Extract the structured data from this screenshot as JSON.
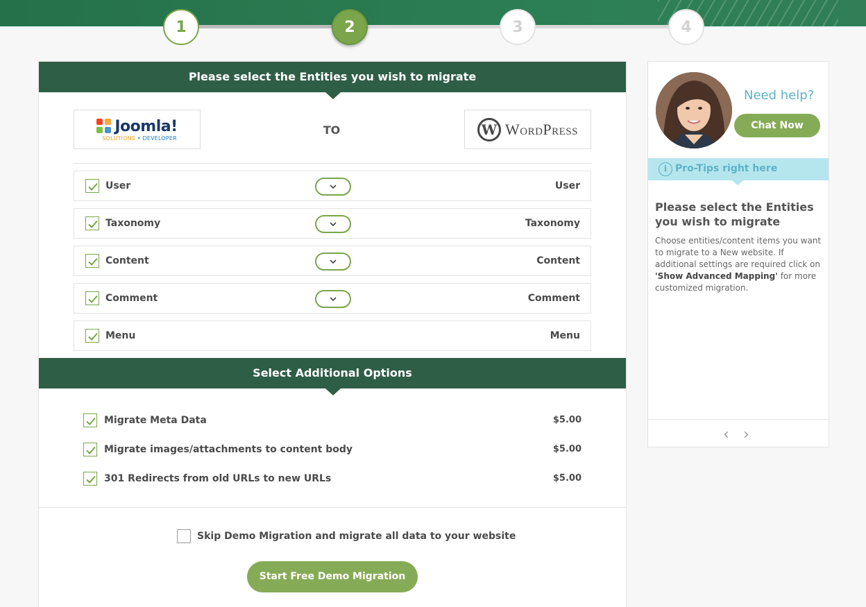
{
  "steps": [
    {
      "number": "1",
      "state": "complete"
    },
    {
      "number": "2",
      "state": "active"
    },
    {
      "number": "3",
      "state": "pending"
    },
    {
      "number": "4",
      "state": "pending"
    }
  ],
  "entities_section": {
    "title": "Please select the Entities you wish to migrate",
    "source_logo": {
      "name": "Joomla!",
      "subtitle_a": "SOLUTIONS",
      "subtitle_b": "DEVELOPER"
    },
    "to_label": "TO",
    "target_logo": {
      "name": "WordPress"
    },
    "rows": [
      {
        "left": "User",
        "right": "User",
        "checked": true,
        "has_toggle": true
      },
      {
        "left": "Taxonomy",
        "right": "Taxonomy",
        "checked": true,
        "has_toggle": true
      },
      {
        "left": "Content",
        "right": "Content",
        "checked": true,
        "has_toggle": true
      },
      {
        "left": "Comment",
        "right": "Comment",
        "checked": true,
        "has_toggle": true
      },
      {
        "left": "Menu",
        "right": "Menu",
        "checked": true,
        "has_toggle": false
      }
    ]
  },
  "options_section": {
    "title": "Select Additional Options",
    "options": [
      {
        "label": "Migrate Meta Data",
        "price": "$5.00",
        "checked": true
      },
      {
        "label": "Migrate images/attachments to content body",
        "price": "$5.00",
        "checked": true
      },
      {
        "label": "301 Redirects from old URLs to new URLs",
        "price": "$5.00",
        "checked": true
      }
    ]
  },
  "skip_demo": {
    "label": "Skip Demo Migration and migrate all data to your website",
    "checked": false
  },
  "start_button": "Start Free Demo Migration",
  "sidebar": {
    "need_help": "Need help?",
    "chat_button": "Chat Now",
    "protips_label": "Pro-Tips right here",
    "tip_title": "Please select the Entities you wish to migrate",
    "tip_body_pre": "Choose entities/content items you want to migrate to a New website. If additional settings are required click on ",
    "tip_body_bold": "'Show Advanced Mapping'",
    "tip_body_post": " for more customized migration."
  },
  "colors": {
    "accent_green": "#86ab57",
    "header_dark_green": "#2f5e47",
    "tip_blue": "#5fb2c8",
    "tip_bg": "#b5e6ee"
  }
}
